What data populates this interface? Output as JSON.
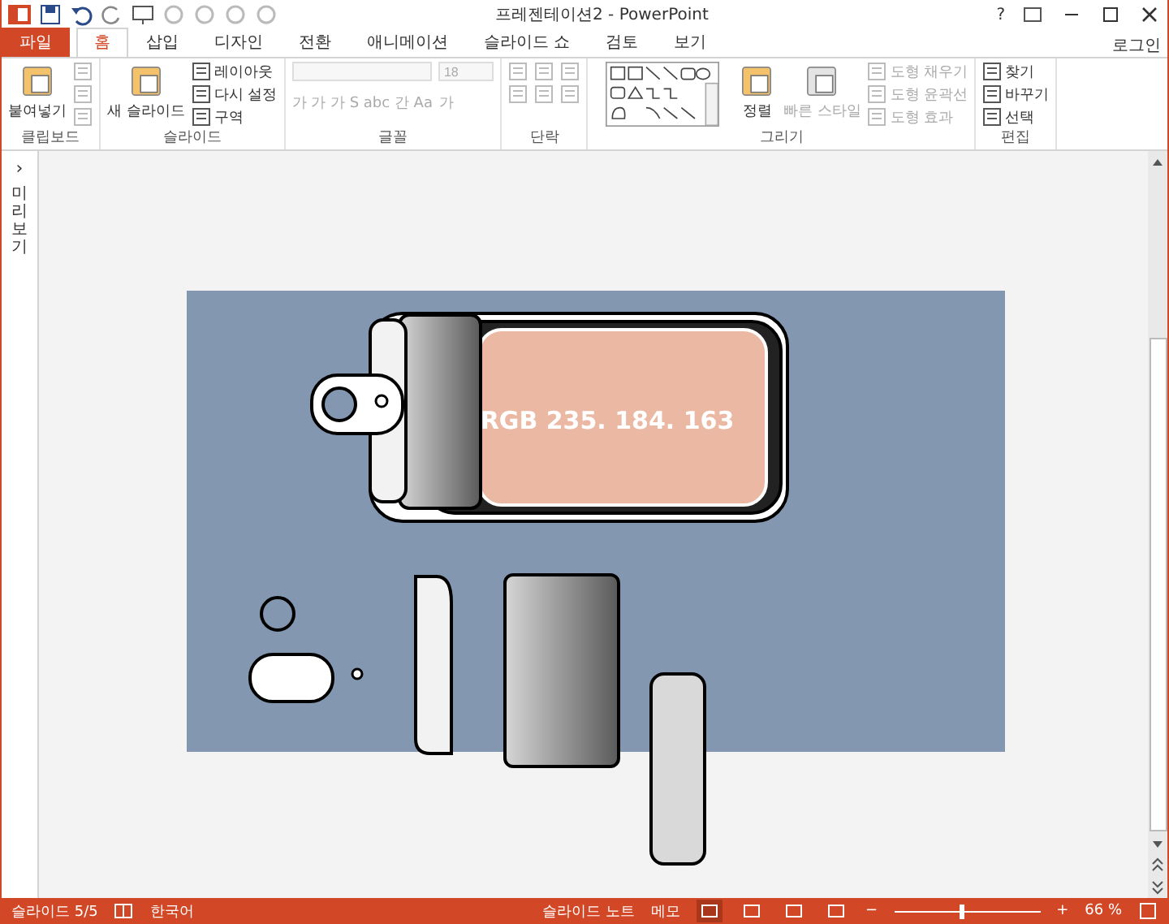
{
  "title_bar": {
    "title": "프레젠테이션2 - PowerPoint",
    "help": "?"
  },
  "tabs": [
    {
      "label": "파일",
      "kind": "file",
      "selected": false
    },
    {
      "label": "홈",
      "kind": "tab",
      "selected": true
    },
    {
      "label": "삽입",
      "kind": "tab",
      "selected": false
    },
    {
      "label": "디자인",
      "kind": "tab",
      "selected": false
    },
    {
      "label": "전환",
      "kind": "tab",
      "selected": false
    },
    {
      "label": "애니메이션",
      "kind": "tab",
      "selected": false
    },
    {
      "label": "슬라이드 쇼",
      "kind": "tab",
      "selected": false
    },
    {
      "label": "검토",
      "kind": "tab",
      "selected": false
    },
    {
      "label": "보기",
      "kind": "tab",
      "selected": false
    }
  ],
  "sign_in": "로그인",
  "ribbon": [
    {
      "label": "클립보드",
      "columns": [
        [
          {
            "kind": "large",
            "label": "붙여넣기",
            "disabled": false
          }
        ],
        [
          {
            "kind": "small",
            "disabled": true
          },
          {
            "kind": "small",
            "disabled": true
          },
          {
            "kind": "small",
            "disabled": true
          }
        ]
      ]
    },
    {
      "label": "슬라이드",
      "columns": [
        [
          {
            "kind": "large",
            "label": "새 슬라이드",
            "disabled": false
          }
        ],
        [
          {
            "kind": "small",
            "label": "레이아웃",
            "disabled": false
          },
          {
            "kind": "small",
            "label": "다시 설정",
            "disabled": false
          },
          {
            "kind": "small",
            "label": "구역",
            "disabled": false
          }
        ]
      ]
    },
    {
      "label": "글꼴",
      "columns": [
        [
          {
            "kind": "field",
            "disabled": true
          },
          {
            "kind": "text",
            "label": "가 가 가 S abc 간 Aa",
            "disabled": true
          }
        ],
        [
          {
            "kind": "field",
            "value": "18",
            "disabled": true
          },
          {
            "kind": "text",
            "label": "가",
            "disabled": true
          }
        ]
      ]
    },
    {
      "label": "단락",
      "columns": [
        [
          {
            "kind": "small",
            "disabled": true
          },
          {
            "kind": "small",
            "disabled": true
          }
        ],
        [
          {
            "kind": "small",
            "disabled": true
          },
          {
            "kind": "small",
            "disabled": true
          }
        ],
        [
          {
            "kind": "small",
            "disabled": true
          },
          {
            "kind": "small",
            "disabled": true
          }
        ]
      ]
    },
    {
      "label": "그리기",
      "columns": [
        [
          {
            "kind": "gallery",
            "disabled": false
          }
        ],
        [
          {
            "kind": "large",
            "label": "정렬",
            "disabled": false
          }
        ],
        [
          {
            "kind": "large",
            "label": "빠른 스타일",
            "disabled": true
          }
        ],
        [
          {
            "kind": "small",
            "label": "도형 채우기",
            "disabled": true
          },
          {
            "kind": "small",
            "label": "도형 윤곽선",
            "disabled": true
          },
          {
            "kind": "small",
            "label": "도형 효과",
            "disabled": true
          }
        ]
      ]
    },
    {
      "label": "편집",
      "columns": [
        [
          {
            "kind": "small",
            "label": "찾기",
            "disabled": false
          },
          {
            "kind": "small",
            "label": "바꾸기",
            "disabled": false
          },
          {
            "kind": "small",
            "label": "선택",
            "disabled": false
          }
        ]
      ]
    }
  ],
  "left_pane": {
    "label": "미리보기",
    "expand": "›"
  },
  "slide": {
    "caption": "RGB 235. 184. 163"
  },
  "status_bar": {
    "slide": "슬라이드 5/5",
    "language": "한국어",
    "notes": "슬라이드 노트",
    "comments": "메모",
    "views": [
      {
        "selected": true
      },
      {
        "selected": false
      },
      {
        "selected": false
      },
      {
        "selected": false
      }
    ],
    "zoom_out": "−",
    "zoom_slider": {
      "level": 0.45
    },
    "zoom_in": "+",
    "zoom": "66 %"
  }
}
